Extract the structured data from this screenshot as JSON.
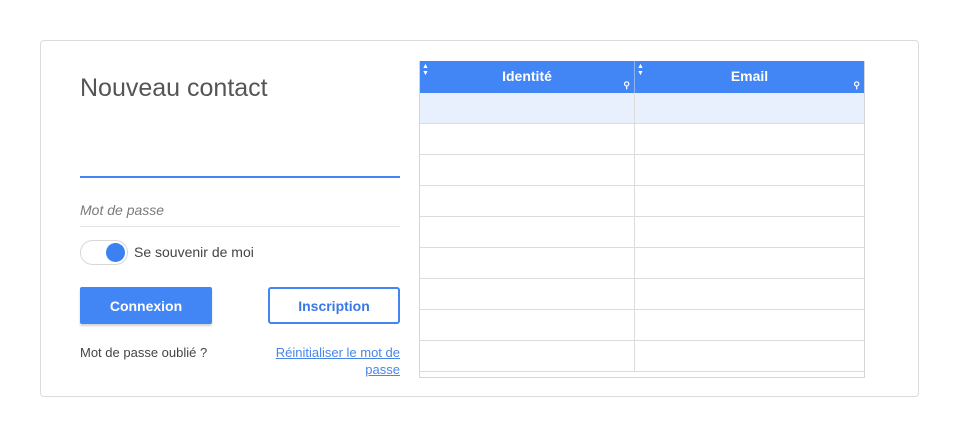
{
  "form": {
    "title": "Nouveau contact",
    "field1_value": "",
    "password_placeholder": "Mot de passe",
    "remember_label": "Se souvenir de moi",
    "remember_checked": true,
    "login_button": "Connexion",
    "signup_button": "Inscription",
    "forgot_text": "Mot de passe oublié ?",
    "reset_link": "Réinitialiser le mot de passe"
  },
  "grid": {
    "columns": [
      "Identité",
      "Email"
    ],
    "row_count": 9,
    "selected_row": 0
  },
  "colors": {
    "accent": "#4285f4",
    "selected_row": "#e8f0fe"
  },
  "icons": {
    "sort": "sort-icon",
    "filter": "filter-icon"
  }
}
